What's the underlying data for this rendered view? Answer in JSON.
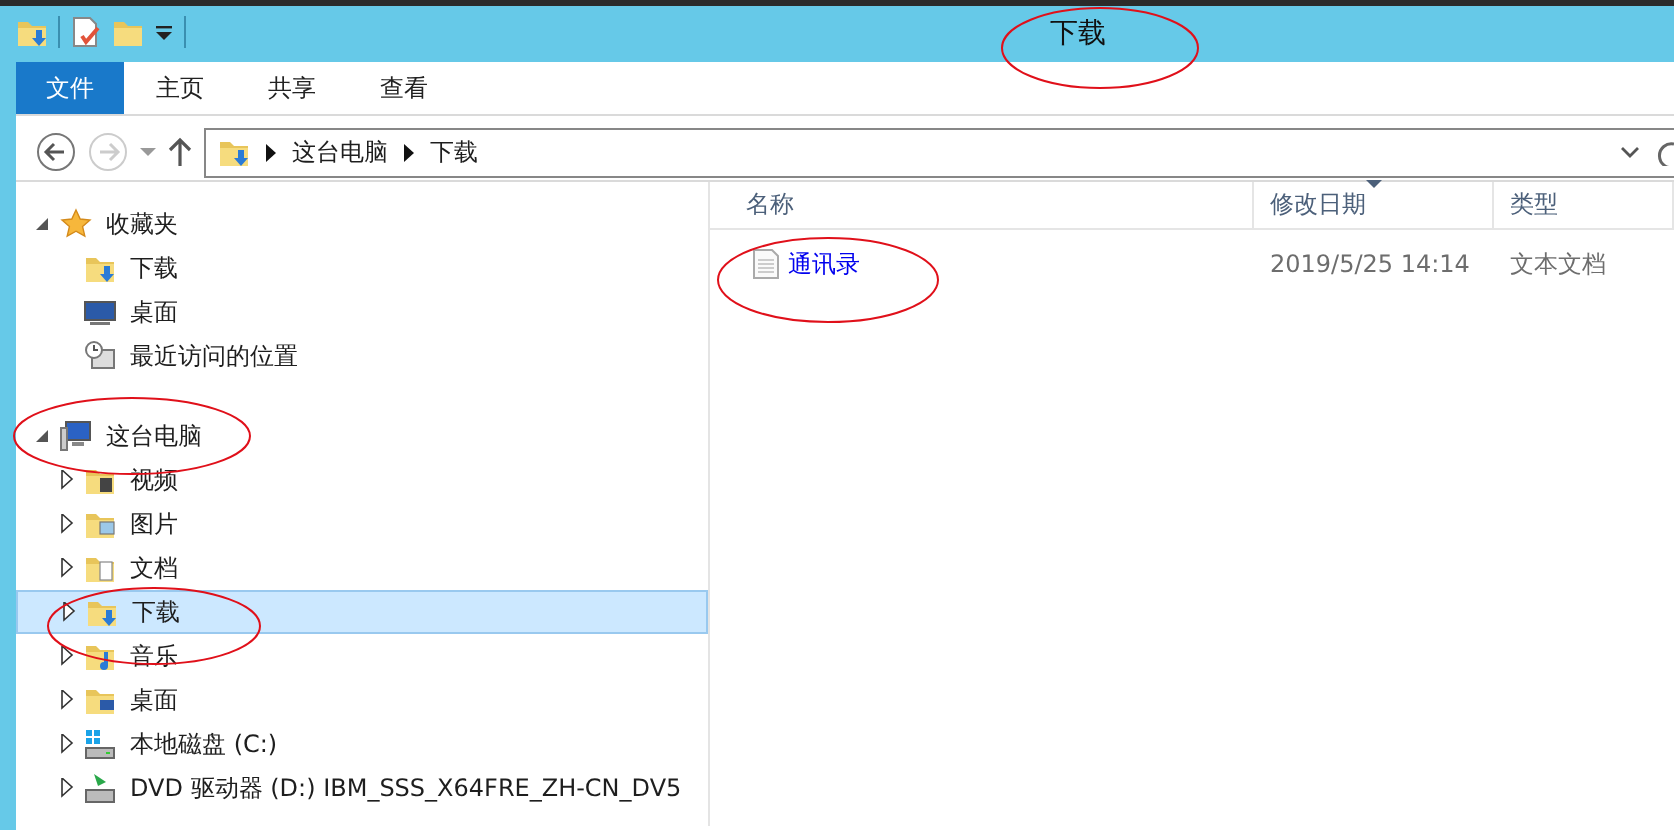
{
  "window": {
    "title": "下载",
    "title_circled": true
  },
  "ribbon_tabs": [
    {
      "label": "文件",
      "kind": "file"
    },
    {
      "label": "主页",
      "kind": "tab"
    },
    {
      "label": "共享",
      "kind": "tab"
    },
    {
      "label": "查看",
      "kind": "tab"
    }
  ],
  "address_bar": {
    "forward_disabled": true,
    "path": [
      "这台电脑",
      "下载"
    ]
  },
  "navigation_tree": [
    {
      "label": "收藏夹",
      "kind": "star",
      "expanded": true,
      "selected": false,
      "circled": false,
      "children": [
        {
          "label": "下载",
          "kind": "download-folder",
          "selected": false,
          "circled": false
        },
        {
          "label": "桌面",
          "kind": "desktop",
          "selected": false,
          "circled": false
        },
        {
          "label": "最近访问的位置",
          "kind": "recent",
          "selected": false,
          "circled": false
        }
      ]
    },
    {
      "label": "这台电脑",
      "kind": "computer",
      "expanded": true,
      "selected": false,
      "circled": true,
      "children": [
        {
          "label": "视频",
          "kind": "video-folder",
          "expanded": false,
          "selected": false,
          "circled": false
        },
        {
          "label": "图片",
          "kind": "picture-folder",
          "expanded": false,
          "selected": false,
          "circled": false
        },
        {
          "label": "文档",
          "kind": "document-folder",
          "expanded": false,
          "selected": false,
          "circled": false
        },
        {
          "label": "下载",
          "kind": "download-folder",
          "expanded": false,
          "selected": true,
          "circled": true
        },
        {
          "label": "音乐",
          "kind": "music-folder",
          "expanded": false,
          "selected": false,
          "circled": false
        },
        {
          "label": "桌面",
          "kind": "desktop-folder",
          "expanded": false,
          "selected": false,
          "circled": false
        },
        {
          "label": "本地磁盘 (C:)",
          "kind": "drive",
          "expanded": false,
          "selected": false,
          "circled": false
        },
        {
          "label": "DVD 驱动器 (D:) IBM_SSS_X64FRE_ZH-CN_DV5",
          "kind": "dvd",
          "expanded": false,
          "selected": false,
          "circled": false
        }
      ]
    }
  ],
  "file_list": {
    "columns": [
      {
        "label": "名称",
        "sorted": false
      },
      {
        "label": "修改日期",
        "sorted": true
      },
      {
        "label": "类型",
        "sorted": false
      }
    ],
    "rows": [
      {
        "name": "通讯录",
        "modified": "2019/5/25 14:14",
        "type": "文本文档",
        "circled": true
      }
    ]
  }
}
